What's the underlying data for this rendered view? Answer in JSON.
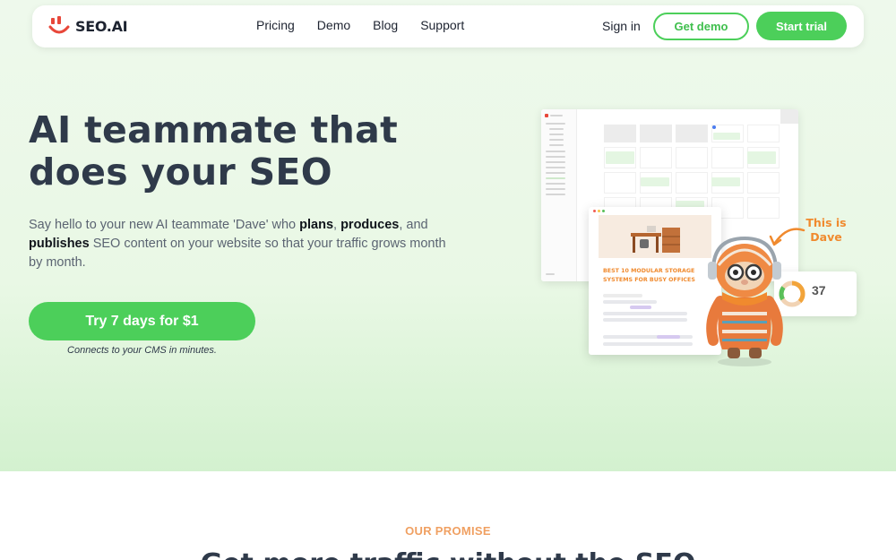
{
  "nav": {
    "logo_text": "SEO.AI",
    "links": [
      "Pricing",
      "Demo",
      "Blog",
      "Support"
    ],
    "signin": "Sign in",
    "get_demo": "Get demo",
    "start_trial": "Start trial"
  },
  "hero": {
    "headline_line1": "AI teammate that",
    "headline_line2": "does your SEO",
    "lead_part1": "Say hello to your new AI teammate 'Dave' who ",
    "lead_bold1": "plans",
    "lead_sep1": ", ",
    "lead_bold2": "produces",
    "lead_sep2": ", and ",
    "lead_bold3": "publishes",
    "lead_part2": " SEO content on your website so that your traffic grows month by month.",
    "cta_label": "Try 7 days for $1",
    "cta_note": "Connects to your CMS in minutes."
  },
  "mockup": {
    "article_title": "BEST 10 MODULAR STORAGE SYSTEMS FOR BUSY OFFICES",
    "score_value": "37",
    "score_fraction": 0.37,
    "dave_label_line1": "This is",
    "dave_label_line2": "Dave"
  },
  "promise": {
    "kicker": "OUR PROMISE",
    "title": "Get more traffic without the SEO"
  },
  "colors": {
    "brand_green": "#4ccf5a",
    "accent_orange": "#f08a2e",
    "heading_dark": "#2f3a4a",
    "logo_red": "#e8473a"
  }
}
